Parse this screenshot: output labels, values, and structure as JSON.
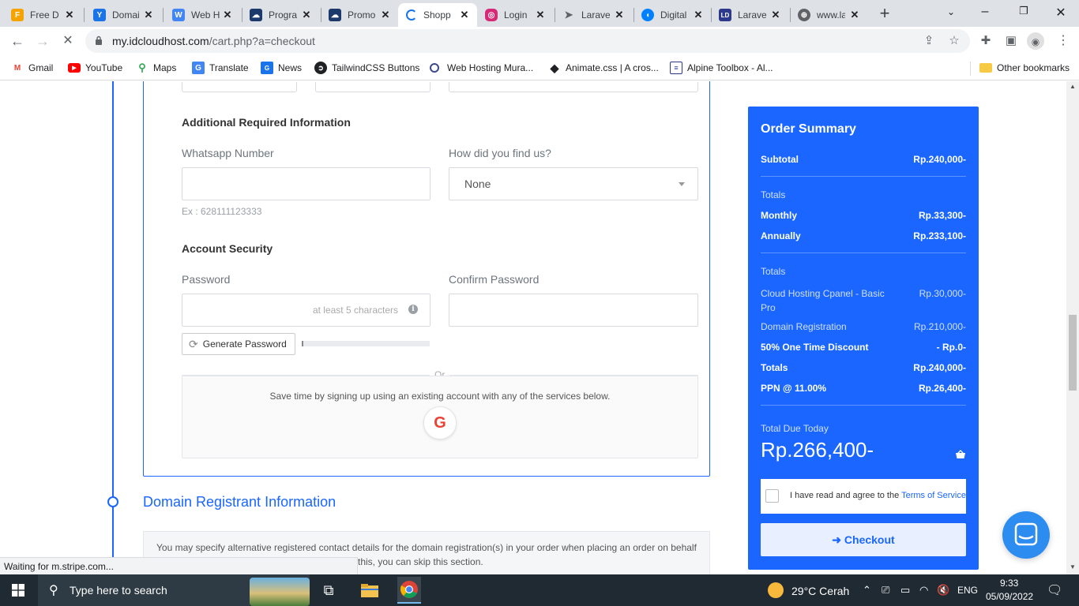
{
  "browser": {
    "tabs": [
      {
        "title": "Free D",
        "icon": "freepik-icon",
        "color": "#f4a300",
        "active": false
      },
      {
        "title": "Domai",
        "icon": "y-icon",
        "color": "#1a73e8",
        "active": false
      },
      {
        "title": "Web H",
        "icon": "webhost-icon",
        "color": "#4285f4",
        "active": false
      },
      {
        "title": "Progra",
        "icon": "idcloudhost-icon",
        "color": "#1b3a6b",
        "active": false
      },
      {
        "title": "Promo",
        "icon": "idcloudhost-icon",
        "color": "#1b3a6b",
        "active": false
      },
      {
        "title": "Shopp",
        "icon": "loading-spinner-icon",
        "color": "#1a73e8",
        "active": true
      },
      {
        "title": "Login",
        "icon": "instagram-icon",
        "color": "#d62976",
        "active": false
      },
      {
        "title": "Larave",
        "icon": "send-icon",
        "color": "#5f6368",
        "active": false
      },
      {
        "title": "Digital",
        "icon": "digitalocean-icon",
        "color": "#0080ff",
        "active": false
      },
      {
        "title": "Larave",
        "icon": "ld-icon",
        "color": "#2d3a8c",
        "active": false
      },
      {
        "title": "www.la",
        "icon": "globe-icon",
        "color": "#5f6368",
        "active": false
      }
    ],
    "url": {
      "host": "my.idcloudhost.com",
      "path": "/cart.php?a=checkout"
    },
    "bookmarks": [
      {
        "label": "Gmail",
        "icon": "gmail-icon",
        "color": "#ea4335"
      },
      {
        "label": "YouTube",
        "icon": "youtube-icon",
        "color": "#ff0000"
      },
      {
        "label": "Maps",
        "icon": "maps-icon",
        "color": "#34a853"
      },
      {
        "label": "Translate",
        "icon": "translate-icon",
        "color": "#4285f4"
      },
      {
        "label": "News",
        "icon": "news-icon",
        "color": "#1a73e8"
      },
      {
        "label": "TailwindCSS Buttons",
        "icon": "tailwind-icon",
        "color": "#202124"
      },
      {
        "label": "Web Hosting Mura...",
        "icon": "hosting-icon",
        "color": "#3c4a8c"
      },
      {
        "label": "Animate.css | A cros...",
        "icon": "animate-icon",
        "color": "#202124"
      },
      {
        "label": "Alpine Toolbox - Al...",
        "icon": "alpine-icon",
        "color": "#2d3a8c"
      }
    ],
    "other_bookmarks": "Other bookmarks",
    "status": "Waiting for m.stripe.com..."
  },
  "form": {
    "additional_title": "Additional Required Information",
    "whatsapp_label": "Whatsapp Number",
    "whatsapp_value": "",
    "whatsapp_hint": "Ex : 628111123333",
    "find_us_label": "How did you find us?",
    "find_us_value": "None",
    "security_title": "Account Security",
    "password_label": "Password",
    "password_hint": "at least 5 characters",
    "confirm_label": "Confirm Password",
    "generate_label": "Generate Password",
    "password_strength": 0.01,
    "or_text": "Or",
    "social_text": "Save time by signing up using an existing account with any of the services below.",
    "google_letter": "G"
  },
  "domain": {
    "heading": "Domain Registrant Information",
    "text_line1": "You may specify alternative registered contact details for the domain registration(s) in your order when placing an order on behalf",
    "text_line2": "this, you can skip this section."
  },
  "summary": {
    "title": "Order Summary",
    "subtotal_label": "Subtotal",
    "subtotal_value": "Rp.240,000-",
    "totals_label_1": "Totals",
    "monthly_label": "Monthly",
    "monthly_value": "Rp.33,300-",
    "annually_label": "Annually",
    "annually_value": "Rp.233,100-",
    "totals_label_2": "Totals",
    "items": [
      {
        "label": "Cloud Hosting Cpanel - Basic Pro",
        "value": "Rp.30,000-"
      },
      {
        "label": "Domain Registration",
        "value": "Rp.210,000-"
      }
    ],
    "discount_label": "50% One Time Discount",
    "discount_value": "- Rp.0-",
    "totals_label": "Totals",
    "totals_value": "Rp.240,000-",
    "ppn_label": "PPN @ 11.00%",
    "ppn_value": "Rp.26,400-",
    "total_due_label": "Total Due Today",
    "total_due_value": "Rp.266,400-",
    "tos_text": "I have read and agree to the ",
    "tos_link": "Terms of Service",
    "checkout_label": "Checkout"
  },
  "taskbar": {
    "search_placeholder": "Type here to search",
    "weather": "29°C  Cerah",
    "lang": "ENG",
    "time": "9:33",
    "date": "05/09/2022"
  },
  "colors": {
    "accent": "#1a66ff",
    "chat": "#2d8cf0"
  }
}
